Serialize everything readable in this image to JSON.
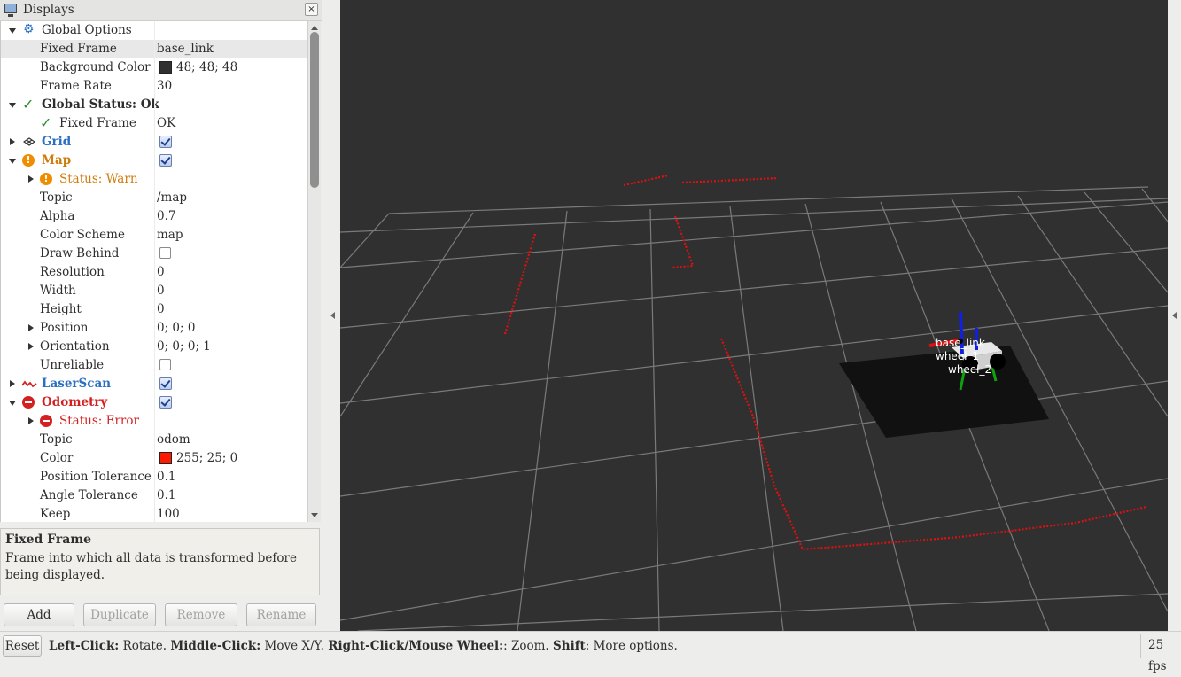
{
  "panel": {
    "title": "Displays",
    "close_glyph": "×",
    "rows": [
      {
        "label": "Global Options",
        "value": "",
        "icon": "gear-icon"
      },
      {
        "label": "Fixed Frame",
        "value": "base_link"
      },
      {
        "label": "Background Color",
        "value": "48; 48; 48",
        "swatch": "#303030"
      },
      {
        "label": "Frame Rate",
        "value": "30"
      },
      {
        "label": "Global Status: Ok",
        "value": "",
        "icon": "check-icon"
      },
      {
        "label": "Fixed Frame",
        "value": "OK",
        "icon": "check-icon"
      },
      {
        "label": "Grid",
        "checked": true,
        "icon": "grid-icon"
      },
      {
        "label": "Map",
        "checked": true,
        "icon": "warning-icon"
      },
      {
        "label": "Status: Warn",
        "icon": "warning-icon"
      },
      {
        "label": "Topic",
        "value": "/map"
      },
      {
        "label": "Alpha",
        "value": "0.7"
      },
      {
        "label": "Color Scheme",
        "value": "map"
      },
      {
        "label": "Draw Behind",
        "checked": false
      },
      {
        "label": "Resolution",
        "value": "0"
      },
      {
        "label": "Width",
        "value": "0"
      },
      {
        "label": "Height",
        "value": "0"
      },
      {
        "label": "Position",
        "value": "0; 0; 0"
      },
      {
        "label": "Orientation",
        "value": "0; 0; 0; 1"
      },
      {
        "label": "Unreliable",
        "checked": false
      },
      {
        "label": "LaserScan",
        "checked": true,
        "icon": "laserscan-icon"
      },
      {
        "label": "Odometry",
        "checked": true,
        "icon": "error-icon"
      },
      {
        "label": "Status: Error",
        "icon": "error-icon"
      },
      {
        "label": "Topic",
        "value": "odom"
      },
      {
        "label": "Color",
        "value": "255; 25; 0",
        "swatch": "#ff1900"
      },
      {
        "label": "Position Tolerance",
        "value": "0.1"
      },
      {
        "label": "Angle Tolerance",
        "value": "0.1"
      },
      {
        "label": "Keep",
        "value": "100"
      }
    ]
  },
  "description": {
    "title": "Fixed Frame",
    "body": "Frame into which all data is transformed before being displayed."
  },
  "buttons": {
    "add": "Add",
    "duplicate": "Duplicate",
    "remove": "Remove",
    "rename": "Rename"
  },
  "statusbar": {
    "reset": "Reset",
    "hint": [
      {
        "key": "Left-Click:",
        "text": " Rotate. "
      },
      {
        "key": "Middle-Click:",
        "text": " Move X/Y. "
      },
      {
        "key": "Right-Click/Mouse Wheel:",
        "text": ": Zoom. "
      },
      {
        "key": "Shift",
        "text": ": More options."
      }
    ],
    "fps": "25 fps"
  },
  "scene": {
    "background": "#303030",
    "laser_color": "#e01010",
    "robot_labels": [
      "base_link",
      "wheel_1",
      "wheel_2"
    ]
  }
}
